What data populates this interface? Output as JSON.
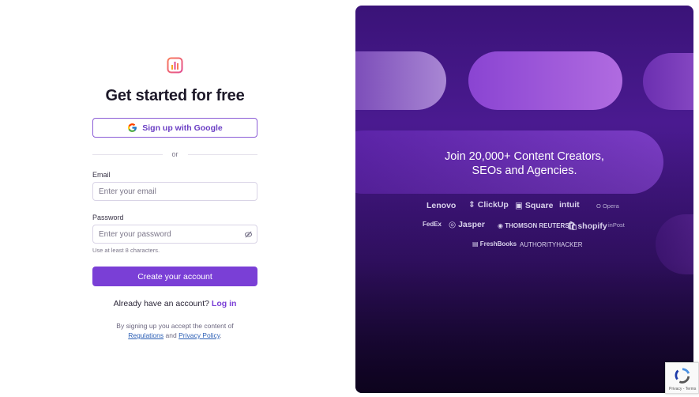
{
  "signup": {
    "title": "Get started for free",
    "google_label": "Sign up with Google",
    "or_text": "or",
    "email_label": "Email",
    "email_placeholder": "Enter your email",
    "password_label": "Password",
    "password_placeholder": "Enter your password",
    "password_hint": "Use at least 8 characters.",
    "create_label": "Create your account",
    "have_account": "Already have an account?",
    "login_link": "Log in",
    "terms_prefix": "By signing up you accept the content of",
    "regulations_link": "Regulations",
    "terms_and": "and",
    "privacy_link": "Privacy Policy",
    "terms_end": "."
  },
  "promo": {
    "headline_line1": "Join 20,000+ Content Creators,",
    "headline_line2": "SEOs and Agencies.",
    "brands": [
      "Lenovo",
      "ClickUp",
      "Square",
      "intuit",
      "Opera",
      "FedEx",
      "Jasper",
      "THOMSON REUTERS",
      "shopify",
      "inPost",
      "FreshBooks",
      "AUTHORITYHACKER"
    ]
  },
  "recaptcha": {
    "links": "Privacy - Terms"
  },
  "colors": {
    "accent": "#7a3fd6",
    "promo_bg": "#3a1378"
  },
  "icons": [
    "logo-icon",
    "google-icon",
    "eye-off-icon",
    "recaptcha-icon"
  ]
}
